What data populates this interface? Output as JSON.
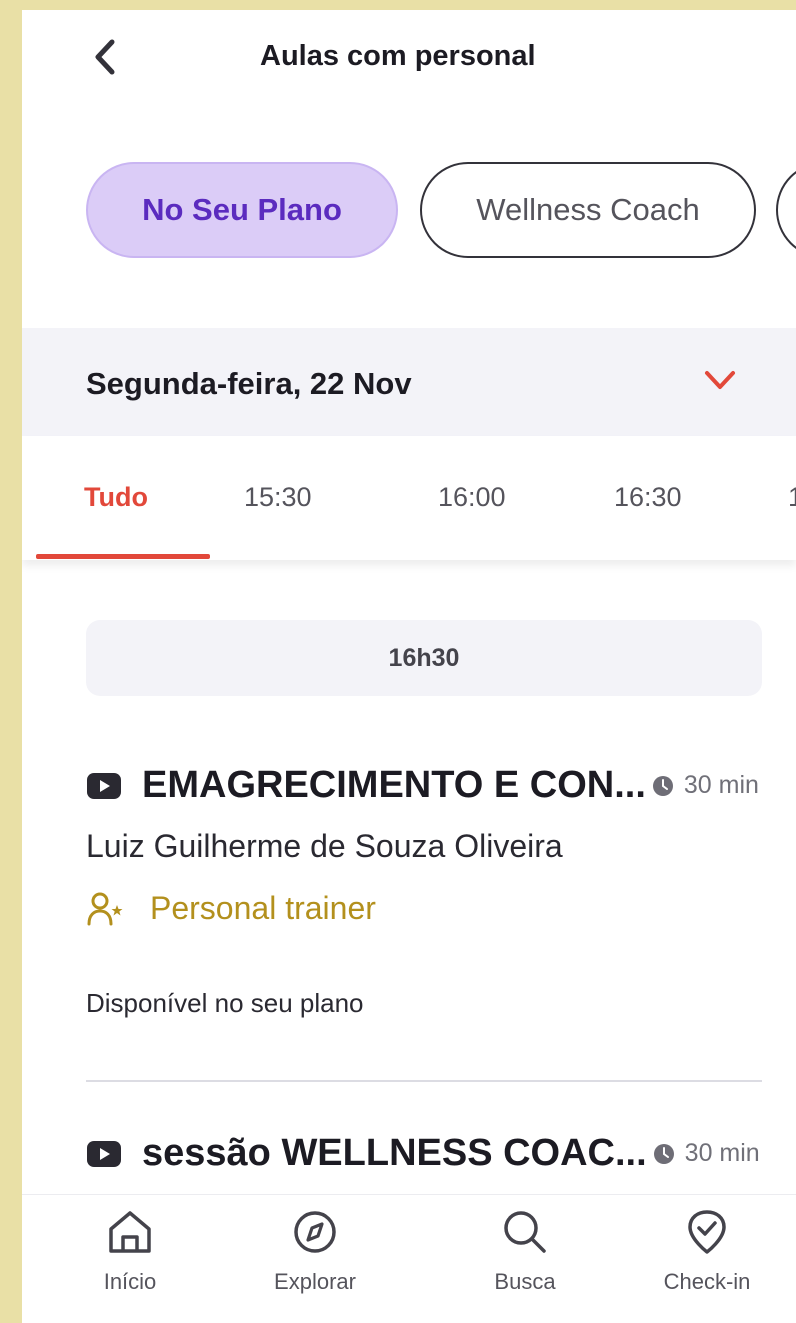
{
  "header": {
    "title": "Aulas com personal"
  },
  "chips": [
    {
      "label": "No Seu Plano",
      "active": true
    },
    {
      "label": "Wellness Coach",
      "active": false
    },
    {
      "label": "",
      "active": false
    }
  ],
  "date": {
    "label": "Segunda-feira, 22 Nov"
  },
  "tabs": [
    {
      "label": "Tudo",
      "active": true
    },
    {
      "label": "15:30"
    },
    {
      "label": "16:00"
    },
    {
      "label": "16:30"
    },
    {
      "label": "1"
    }
  ],
  "time_group": "16h30",
  "classes": [
    {
      "name": "EMAGRECIMENTO E CON...",
      "duration": "30 min",
      "trainer": "Luiz Guilherme de Souza Oliveira",
      "badge": "Personal trainer",
      "availability": "Disponível no seu plano"
    },
    {
      "name": "sessão WELLNESS COAC...",
      "duration": "30 min"
    }
  ],
  "bottom_nav": [
    {
      "label": "Início",
      "icon": "home-icon"
    },
    {
      "label": "Explorar",
      "icon": "compass-icon"
    },
    {
      "label": "Busca",
      "icon": "search-icon"
    },
    {
      "label": "Check-in",
      "icon": "checkin-icon"
    }
  ],
  "colors": {
    "accent_red": "#e2483a",
    "chip_active_bg": "#dbccf7",
    "chip_active_text": "#5b2bbf",
    "badge_gold": "#b3901d",
    "background_outer": "#e9e0a6"
  }
}
